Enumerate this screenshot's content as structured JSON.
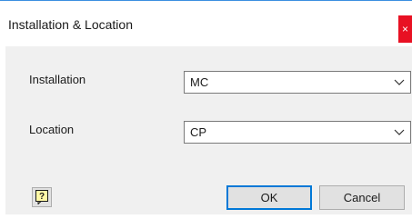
{
  "window": {
    "title": "Installation & Location",
    "close_glyph": "×"
  },
  "form": {
    "installation": {
      "label": "Installation",
      "value": "MC"
    },
    "location": {
      "label": "Location",
      "value": "CP"
    }
  },
  "buttons": {
    "help_icon": "help-icon",
    "ok_label": "OK",
    "cancel_label": "Cancel"
  },
  "colors": {
    "close_red": "#e81123",
    "accent_blue": "#0078d7",
    "dialog_bg": "#f0f0f0",
    "help_icon_fill": "#fff8a6"
  }
}
